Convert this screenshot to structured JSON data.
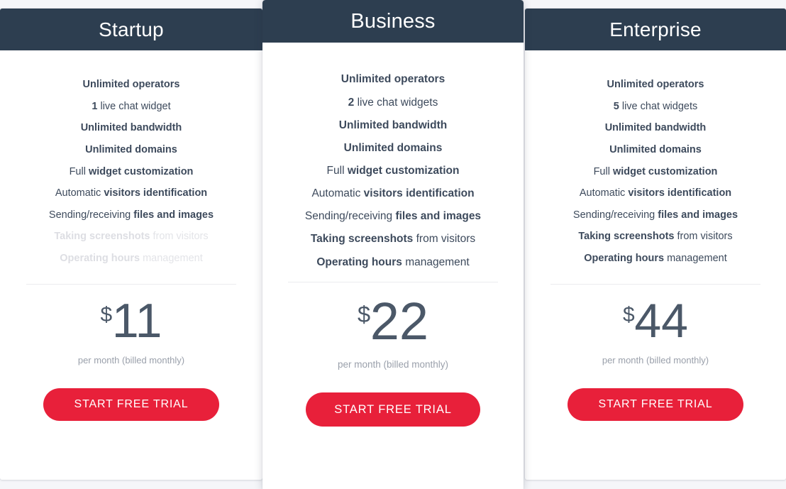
{
  "page": {
    "background_color": "#f5f6f9",
    "header_color": "#2d3e50",
    "cta_color": "#e8203a",
    "price_color": "#4b5868",
    "feature_color": "#3d4a5c",
    "disabled_color": "#e3e4e8"
  },
  "plans": [
    {
      "id": "startup",
      "name": "Startup",
      "featured": false,
      "features": [
        {
          "lead": "",
          "em": "Unlimited operators",
          "tail": "",
          "enabled": true
        },
        {
          "lead": "",
          "em": "1",
          "tail": " live chat widget",
          "enabled": true
        },
        {
          "lead": "",
          "em": "Unlimited bandwidth",
          "tail": "",
          "enabled": true
        },
        {
          "lead": "",
          "em": "Unlimited domains",
          "tail": "",
          "enabled": true
        },
        {
          "lead": "Full ",
          "em": "widget customization",
          "tail": "",
          "enabled": true
        },
        {
          "lead": "Automatic ",
          "em": "visitors identification",
          "tail": "",
          "enabled": true
        },
        {
          "lead": "Sending/receiving ",
          "em": "files and images",
          "tail": "",
          "enabled": true
        },
        {
          "lead": "",
          "em": "Taking screenshots",
          "tail": " from visitors",
          "enabled": false
        },
        {
          "lead": "",
          "em": "Operating hours",
          "tail": " management",
          "enabled": false
        }
      ],
      "price": {
        "currency": "$",
        "amount": "11",
        "period": "per month (billed monthly)"
      },
      "cta_label": "START FREE TRIAL"
    },
    {
      "id": "business",
      "name": "Business",
      "featured": true,
      "features": [
        {
          "lead": "",
          "em": "Unlimited operators",
          "tail": "",
          "enabled": true
        },
        {
          "lead": "",
          "em": "2",
          "tail": " live chat widgets",
          "enabled": true
        },
        {
          "lead": "",
          "em": "Unlimited bandwidth",
          "tail": "",
          "enabled": true
        },
        {
          "lead": "",
          "em": "Unlimited domains",
          "tail": "",
          "enabled": true
        },
        {
          "lead": "Full ",
          "em": "widget customization",
          "tail": "",
          "enabled": true
        },
        {
          "lead": "Automatic ",
          "em": "visitors identification",
          "tail": "",
          "enabled": true
        },
        {
          "lead": "Sending/receiving ",
          "em": "files and images",
          "tail": "",
          "enabled": true
        },
        {
          "lead": "",
          "em": "Taking screenshots",
          "tail": " from visitors",
          "enabled": true
        },
        {
          "lead": "",
          "em": "Operating hours",
          "tail": " management",
          "enabled": true
        }
      ],
      "price": {
        "currency": "$",
        "amount": "22",
        "period": "per month (billed monthly)"
      },
      "cta_label": "START FREE TRIAL"
    },
    {
      "id": "enterprise",
      "name": "Enterprise",
      "featured": false,
      "features": [
        {
          "lead": "",
          "em": "Unlimited operators",
          "tail": "",
          "enabled": true
        },
        {
          "lead": "",
          "em": "5",
          "tail": " live chat widgets",
          "enabled": true
        },
        {
          "lead": "",
          "em": "Unlimited bandwidth",
          "tail": "",
          "enabled": true
        },
        {
          "lead": "",
          "em": "Unlimited domains",
          "tail": "",
          "enabled": true
        },
        {
          "lead": "Full ",
          "em": "widget customization",
          "tail": "",
          "enabled": true
        },
        {
          "lead": "Automatic ",
          "em": "visitors identification",
          "tail": "",
          "enabled": true
        },
        {
          "lead": "Sending/receiving ",
          "em": "files and images",
          "tail": "",
          "enabled": true
        },
        {
          "lead": "",
          "em": "Taking screenshots",
          "tail": " from visitors",
          "enabled": true
        },
        {
          "lead": "",
          "em": "Operating hours",
          "tail": " management",
          "enabled": true
        }
      ],
      "price": {
        "currency": "$",
        "amount": "44",
        "period": "per month (billed monthly)"
      },
      "cta_label": "START FREE TRIAL"
    }
  ]
}
